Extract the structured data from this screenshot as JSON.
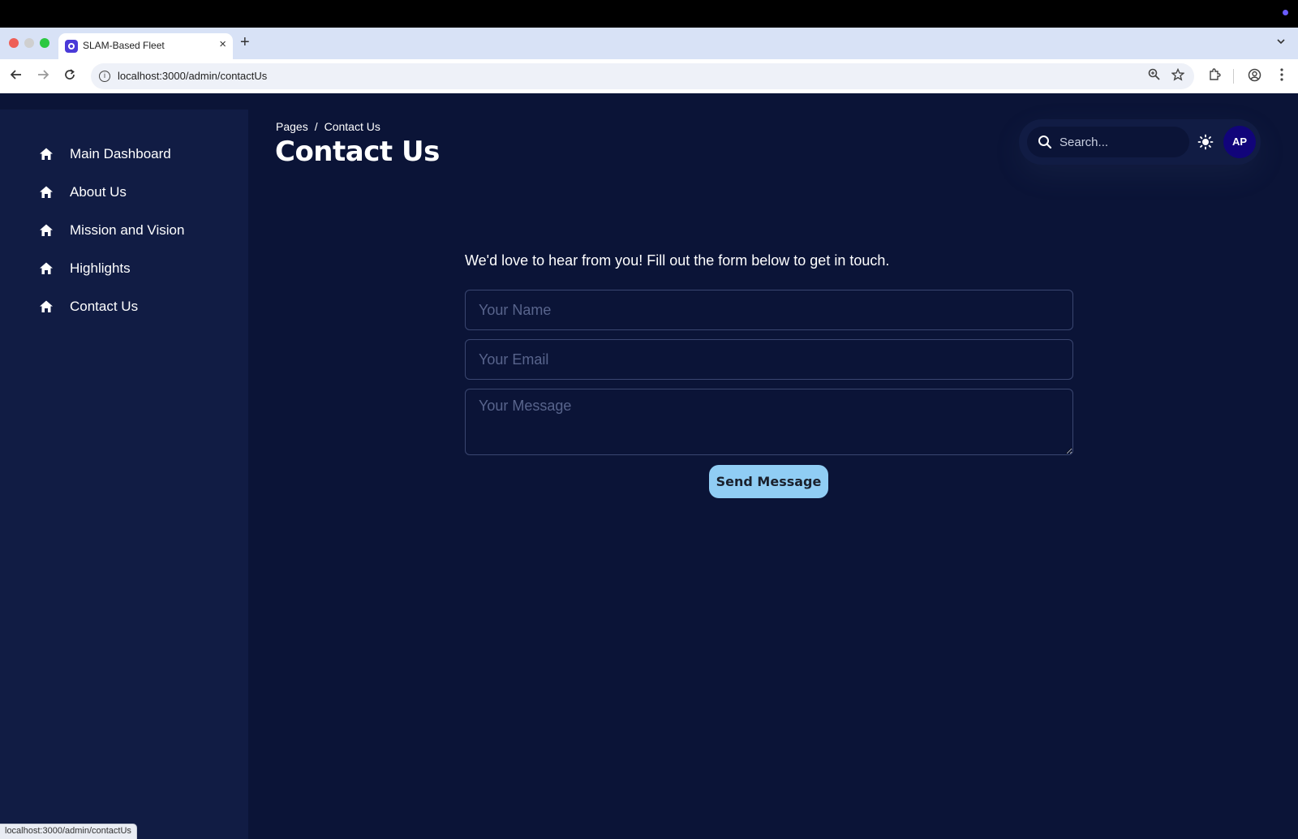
{
  "browser": {
    "tab_title": "SLAM-Based Fleet",
    "tab_close": "×",
    "new_tab": "+",
    "url": "localhost:3000/admin/contactUs",
    "status_url": "localhost:3000/admin/contactUs"
  },
  "sidebar": {
    "items": [
      {
        "label": "Main Dashboard",
        "icon": "home-icon"
      },
      {
        "label": "About Us",
        "icon": "home-icon"
      },
      {
        "label": "Mission and Vision",
        "icon": "home-icon"
      },
      {
        "label": "Highlights",
        "icon": "home-icon"
      },
      {
        "label": "Contact Us",
        "icon": "home-icon"
      }
    ]
  },
  "header": {
    "breadcrumb_root": "Pages",
    "breadcrumb_sep": "/",
    "breadcrumb_current": "Contact Us",
    "title": "Contact Us",
    "search_placeholder": "Search...",
    "avatar_initials": "AP"
  },
  "form": {
    "intro": "We'd love to hear from you! Fill out the form below to get in touch.",
    "name_placeholder": "Your Name",
    "email_placeholder": "Your Email",
    "message_placeholder": "Your Message",
    "submit_label": "Send Message"
  },
  "colors": {
    "background": "#0b1437",
    "sidebar": "#111c44",
    "button": "#90cdf4",
    "avatar": "#11047a"
  }
}
